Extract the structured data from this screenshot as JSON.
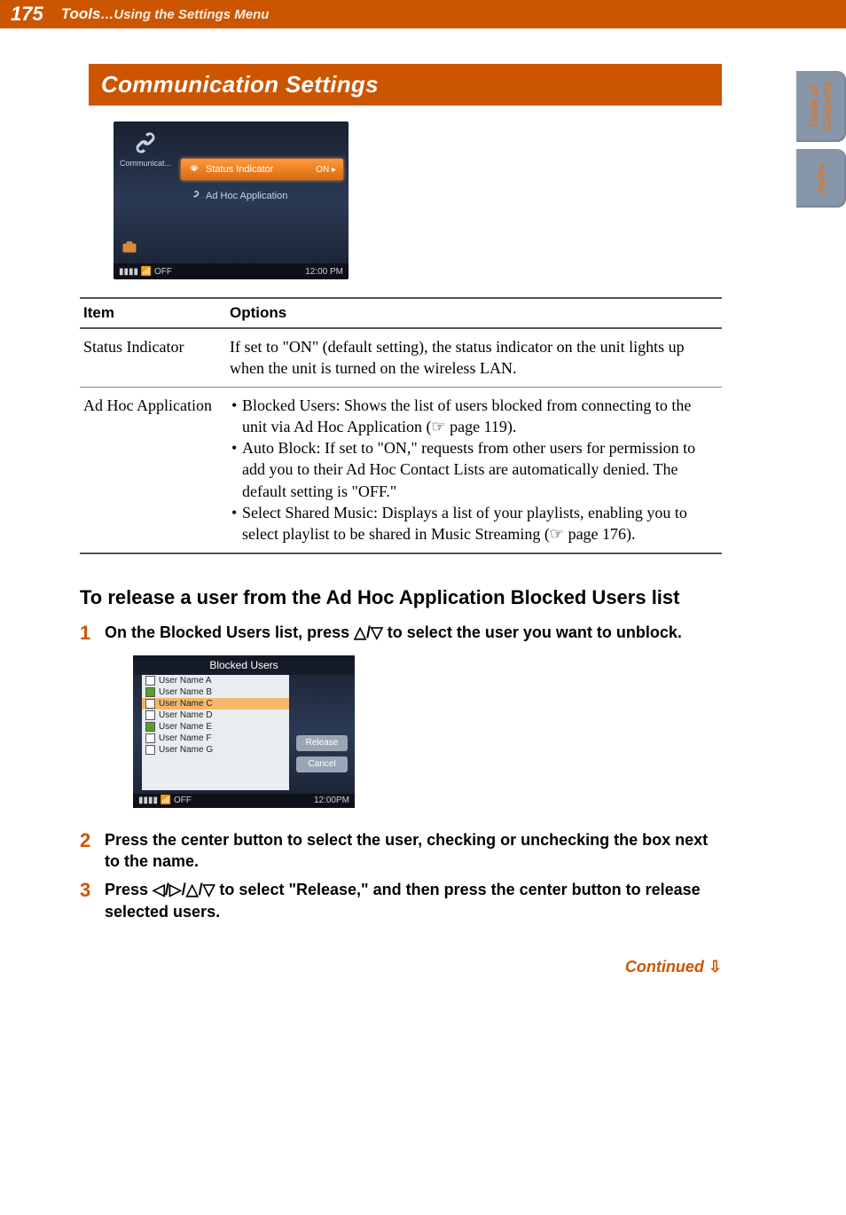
{
  "header": {
    "page_number": "175",
    "chapter": "Tools",
    "ellipsis": "…",
    "section": "Using the Settings Menu"
  },
  "side_tabs": {
    "toc_line1": "Table of",
    "toc_line2": "Contents",
    "index": "Index"
  },
  "section_title": "Communication Settings",
  "screenshot1": {
    "left_label": "Communicat...",
    "row1_label": "Status Indicator",
    "row1_value": "ON",
    "row2_label": "Ad Hoc Application",
    "footer_left": "OFF",
    "footer_right": "12:00 PM"
  },
  "table": {
    "head_item": "Item",
    "head_options": "Options",
    "r1_item": "Status Indicator",
    "r1_opt": "If set to \"ON\" (default setting), the status indicator on the unit lights up when the unit is turned on the wireless LAN.",
    "r2_item": "Ad Hoc Application",
    "r2_b1a": "Blocked Users: Shows the list of users blocked from connecting to the unit via Ad Hoc Application (",
    "r2_b1_ref": " page 119).",
    "r2_b2": "Auto Block: If set to \"ON,\" requests from other users for permission to add you to their Ad Hoc Contact Lists are automatically denied. The default setting is \"OFF.\"",
    "r2_b3a": "Select Shared Music: Displays a list of your playlists, enabling you to select playlist to be shared in Music Streaming (",
    "r2_b3_ref": " page 176)."
  },
  "subheading": "To release a user from the Ad Hoc Application Blocked Users list",
  "steps": {
    "s1_num": "1",
    "s1a": "On the Blocked Users list, press ",
    "s1b": " to select the user you want to unblock.",
    "s2_num": "2",
    "s2": "Press the center button to select the user, checking or unchecking the box next to the name.",
    "s3_num": "3",
    "s3a": "Press ",
    "s3b": " to select \"Release,\" and then press the center button to release selected users."
  },
  "nav_updown": "△/▽",
  "nav_all": "◁/▷/△/▽",
  "pointer_glyph": "☞",
  "screenshot2": {
    "title": "Blocked Users",
    "users": [
      "User Name A",
      "User Name B",
      "User Name C",
      "User Name D",
      "User Name E",
      "User Name F",
      "User Name G"
    ],
    "btn_release": "Release",
    "btn_cancel": "Cancel",
    "footer_left": "OFF",
    "footer_right": "12:00PM"
  },
  "continued": "Continued",
  "continued_arrow": "⇩"
}
